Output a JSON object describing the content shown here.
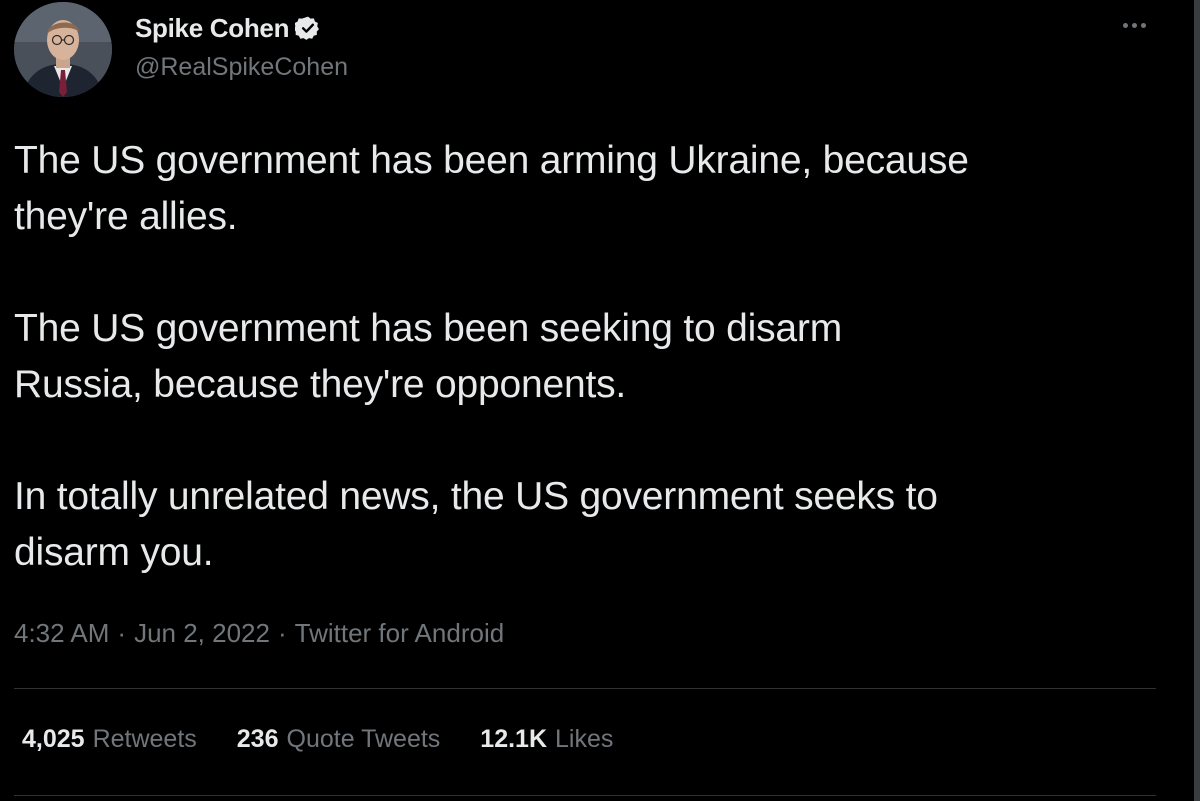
{
  "author": {
    "name": "Spike Cohen",
    "handle": "@RealSpikeCohen",
    "verified_color": "#e7e9ea"
  },
  "tweet": {
    "text": "The US government has been arming Ukraine, because\nthey're allies.\n\nThe US government has been seeking to disarm\nRussia, because they're opponents.\n\nIn totally unrelated news, the US government seeks to\ndisarm you."
  },
  "meta": {
    "time": "4:32 AM",
    "date": "Jun 2, 2022",
    "source": "Twitter for Android",
    "separator": "·"
  },
  "stats": {
    "retweets": {
      "count": "4,025",
      "label": "Retweets"
    },
    "quotes": {
      "count": "236",
      "label": "Quote Tweets"
    },
    "likes": {
      "count": "12.1K",
      "label": "Likes"
    }
  },
  "icons": {
    "more": "more-horizontal-icon",
    "verified": "verified-badge-icon"
  },
  "colors": {
    "background": "#000000",
    "text": "#e7e9ea",
    "secondary": "#71767b",
    "divider": "#2f3336"
  }
}
